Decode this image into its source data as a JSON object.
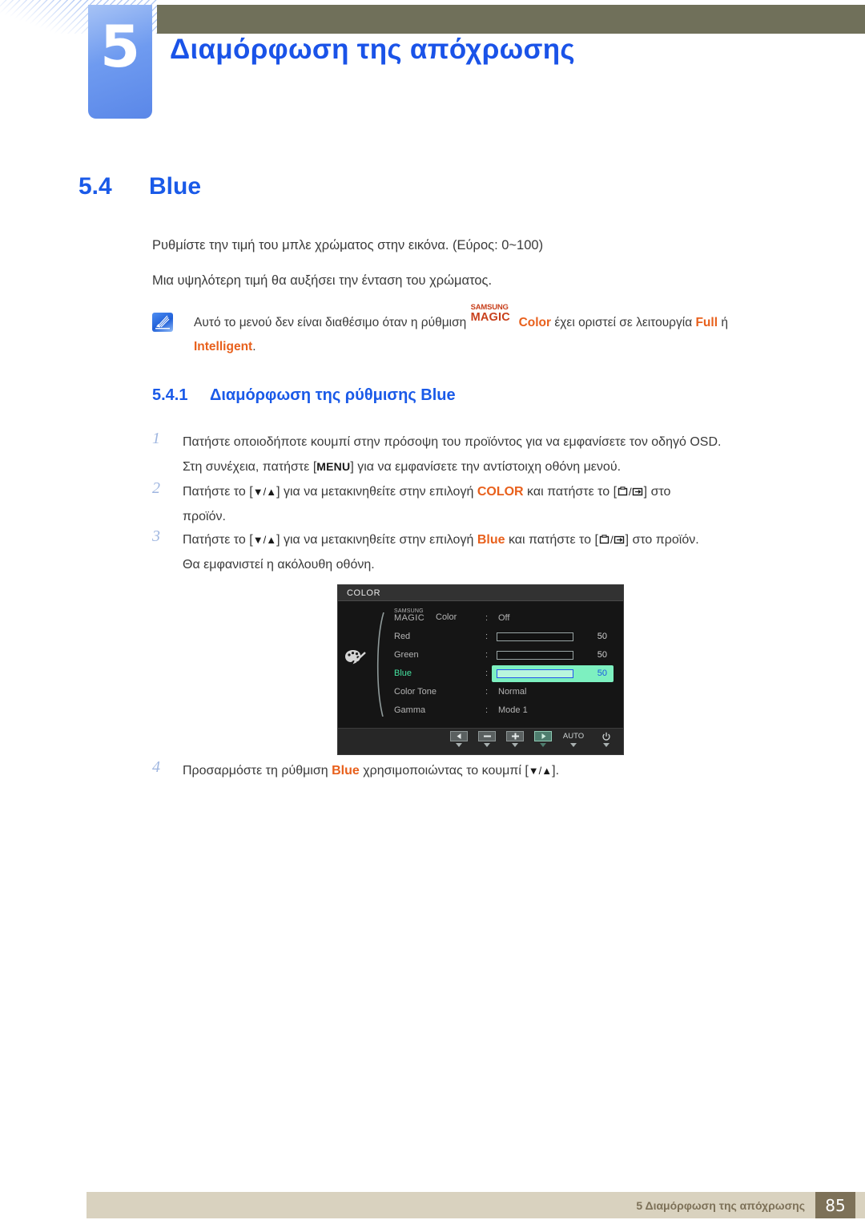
{
  "header": {
    "chapter_number": "5",
    "chapter_title": "Διαμόρφωση της απόχρωσης"
  },
  "section": {
    "number": "5.4",
    "title": "Blue"
  },
  "paragraphs": {
    "p1": "Ρυθμίστε την τιμή του μπλε χρώματος στην εικόνα. (Εύρος: 0~100)",
    "p2": "Μια υψηλότερη τιμή θα αυξήσει την ένταση του χρώματος."
  },
  "note": {
    "icon": "note-pencil-icon",
    "text_before": "Αυτό το μενού δεν είναι διαθέσιμο όταν η ρύθμιση",
    "magic_samsung": "SAMSUNG",
    "magic_magic": "MAGIC",
    "magic_color": "Color",
    "text_middle": "έχει οριστεί σε λειτουργία",
    "kw_full": "Full",
    "text_or": "ή",
    "kw_intelligent": "Intelligent",
    "text_end": "."
  },
  "subsection": {
    "number": "5.4.1",
    "title": "Διαμόρφωση της ρύθμισης Blue"
  },
  "steps": [
    {
      "num": "1",
      "line1_a": "Πατήστε οποιοδήποτε κουμπί στην πρόσοψη του προϊόντος για να εμφανίσετε τον οδηγό OSD.",
      "line2_a": "Στη συνέχεια, πατήστε [",
      "key_menu": "MENU",
      "line2_b": "] για να εμφανίσετε την αντίστοιχη οθόνη μενού."
    },
    {
      "num": "2",
      "t1": "Πατήστε το [",
      "t2": "] για να μετακινηθείτε στην επιλογή",
      "kw": "COLOR",
      "t3": "και πατήστε το [",
      "t4": "] στο",
      "t5": "προϊόν."
    },
    {
      "num": "3",
      "t1": "Πατήστε το [",
      "t2": "] για να μετακινηθείτε στην επιλογή",
      "kw": "Blue",
      "t3": "και πατήστε το [",
      "t4": "] στο προϊόν.",
      "t5": "Θα εμφανιστεί η ακόλουθη οθόνη."
    },
    {
      "num": "4",
      "t1": "Προσαρμόστε τη ρύθμιση",
      "kw": "Blue",
      "t2": "χρησιμοποιώντας το κουμπί [",
      "t3": "]."
    }
  ],
  "osd": {
    "title": "COLOR",
    "palette_icon": "palette-brush-icon",
    "rows": [
      {
        "id": "magic-color",
        "label_samsung": "SAMSUNG",
        "label_magic": "MAGIC",
        "label_color": "Color",
        "colon": ":",
        "value": "Off",
        "type": "value"
      },
      {
        "id": "red",
        "label": "Red",
        "colon": ":",
        "type": "slider",
        "fill_percent": 50,
        "number": "50"
      },
      {
        "id": "green",
        "label": "Green",
        "colon": ":",
        "type": "slider",
        "fill_percent": 50,
        "number": "50"
      },
      {
        "id": "blue",
        "label": "Blue",
        "colon": ":",
        "type": "slider",
        "fill_percent": 50,
        "number": "50",
        "active": true
      },
      {
        "id": "color-tone",
        "label": "Color Tone",
        "colon": ":",
        "value": "Normal",
        "type": "value"
      },
      {
        "id": "gamma",
        "label": "Gamma",
        "colon": ":",
        "value": "Mode 1",
        "type": "value"
      }
    ],
    "buttons": [
      {
        "id": "back",
        "icon": "left-arrow-icon",
        "label": ""
      },
      {
        "id": "minus",
        "icon": "minus-icon",
        "label": ""
      },
      {
        "id": "plus",
        "icon": "plus-icon",
        "label": ""
      },
      {
        "id": "enter",
        "icon": "right-arrow-icon",
        "label": "",
        "highlighted": true
      },
      {
        "id": "auto",
        "icon": "auto-text",
        "label": "AUTO"
      },
      {
        "id": "power",
        "icon": "power-icon",
        "label": ""
      }
    ]
  },
  "footer": {
    "text": "5 Διαμόρφωση της απόχρωσης",
    "page_number": "85"
  },
  "colors": {
    "accent_blue": "#1a5ae8",
    "header_bar": "#70705a",
    "keyword_orange": "#e8601c",
    "magic_red": "#c8401c",
    "footer_bar": "#d9d2bf",
    "footer_box": "#7d7158",
    "osd_highlight": "#7df0c0",
    "osd_slider_fill": "#1e58e8"
  }
}
